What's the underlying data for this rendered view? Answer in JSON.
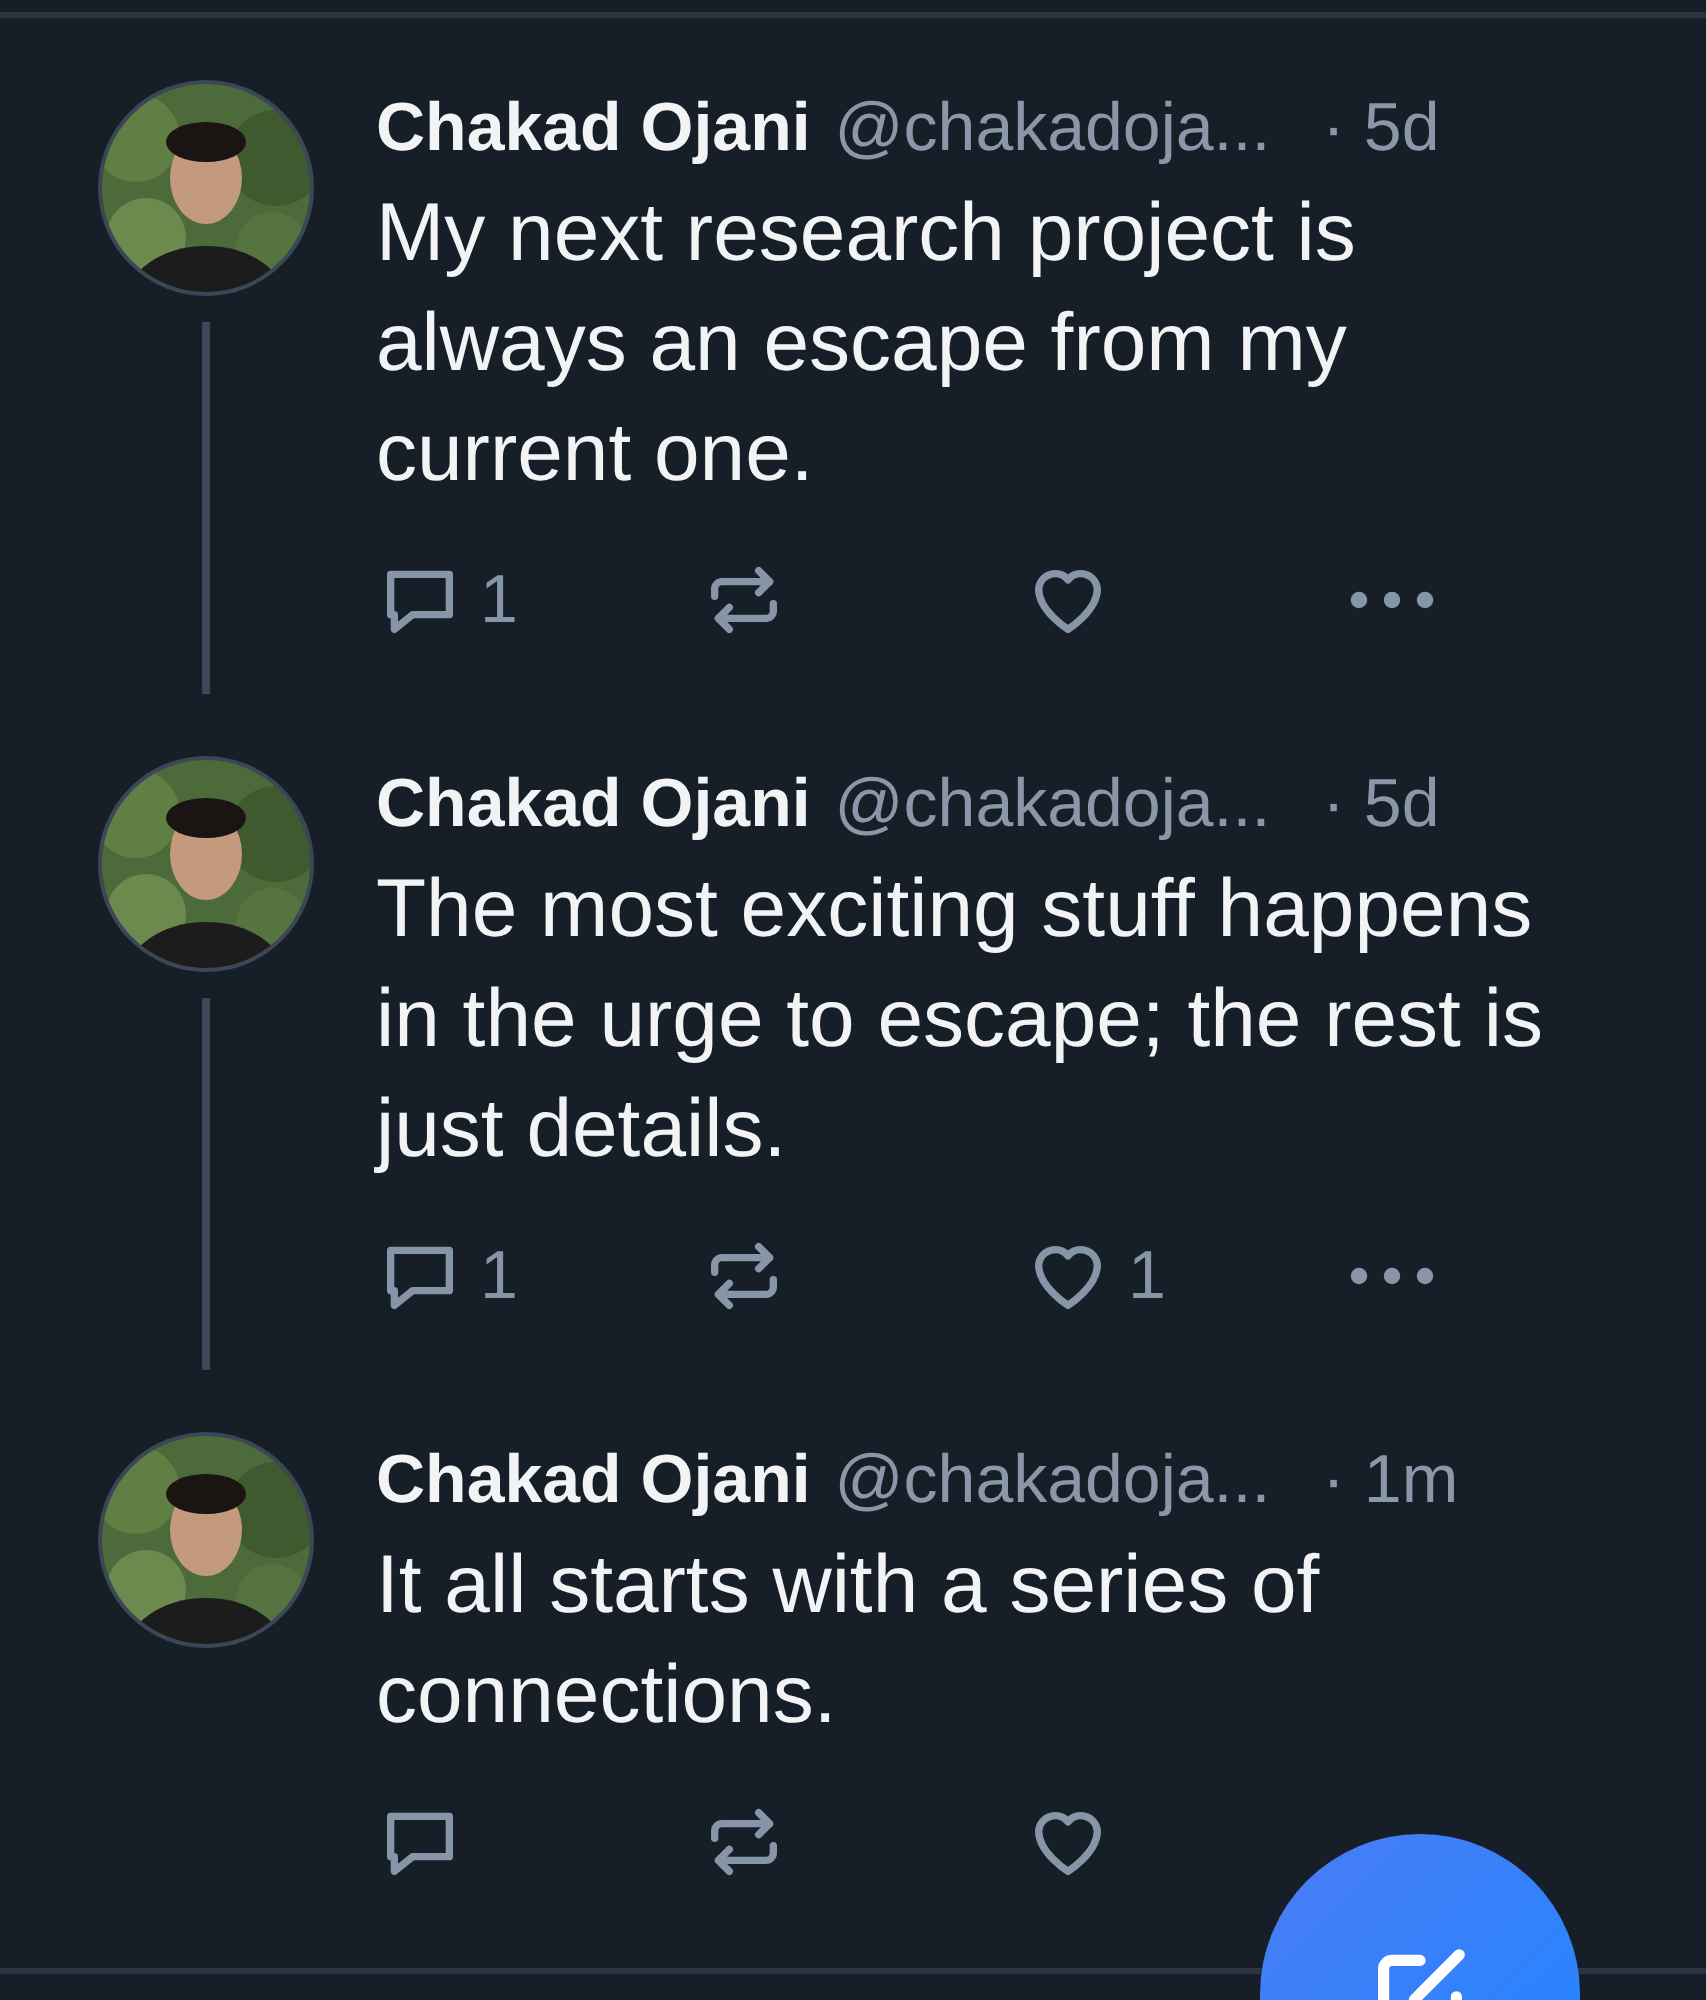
{
  "posts": [
    {
      "author": "Chakad Ojani",
      "handle": "@chakadoja...",
      "time": "· 5d",
      "text": "My next research project is always an escape from my current one.",
      "reply_count": "1",
      "thread_line": true
    },
    {
      "author": "Chakad Ojani",
      "handle": "@chakadoja...",
      "time": "· 5d",
      "text": "The most exciting stuff happens in the urge to escape; the rest is just details.",
      "reply_count": "1",
      "like_count": "1",
      "thread_line": true
    },
    {
      "author": "Chakad Ojani",
      "handle": "@chakadoja...",
      "time": "· 1m",
      "text": "It all starts with a series of connections."
    }
  ]
}
